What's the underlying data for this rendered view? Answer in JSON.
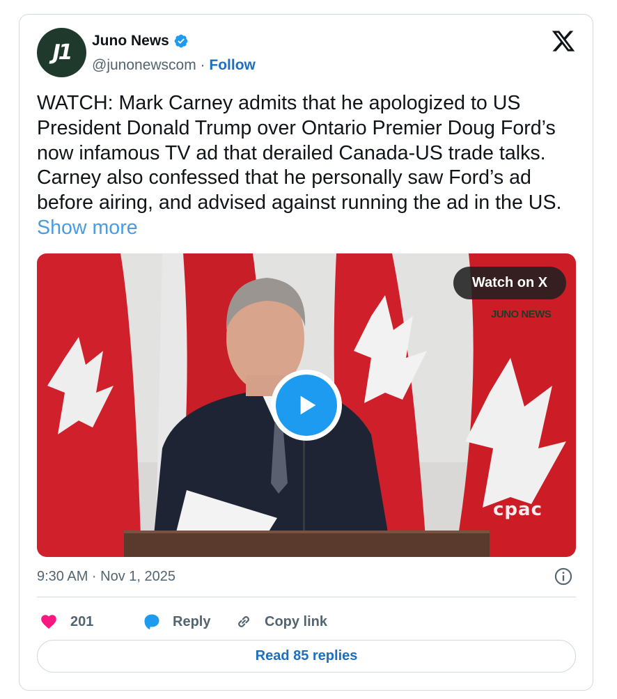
{
  "author": {
    "display_name": "Juno News",
    "handle": "@junonewscom",
    "separator": " · ",
    "follow_label": "Follow",
    "avatar_text": "J1"
  },
  "tweet": {
    "text": "WATCH: Mark Carney admits that he apologized to US President Donald Trump over Ontario Premier Doug Ford’s now infamous TV ad that derailed Canada-US trade talks. Carney also confessed that he personally saw Ford’s ad before airing, and advised against running the ad in the US.",
    "show_more_label": "Show more",
    "timestamp": "9:30 AM · Nov 1, 2025"
  },
  "media": {
    "watch_label": "Watch on X",
    "watermark_text": "JUNO NEWS",
    "broadcaster_logo_text": "cpac"
  },
  "actions": {
    "like_count": "201",
    "reply_label": "Reply",
    "copy_link_label": "Copy link",
    "read_replies_label": "Read 85 replies"
  },
  "icons": {
    "verified": "verified-badge-icon",
    "x_logo": "x-logo-icon",
    "info": "info-icon",
    "heart": "heart-icon",
    "reply": "reply-bubble-icon",
    "link": "link-icon",
    "play": "play-icon"
  },
  "colors": {
    "brand_blue": "#1d9bf0",
    "link_blue": "#1d6fbf",
    "like_pink": "#f91880",
    "muted_text": "#536471",
    "border": "#cfd9de"
  }
}
